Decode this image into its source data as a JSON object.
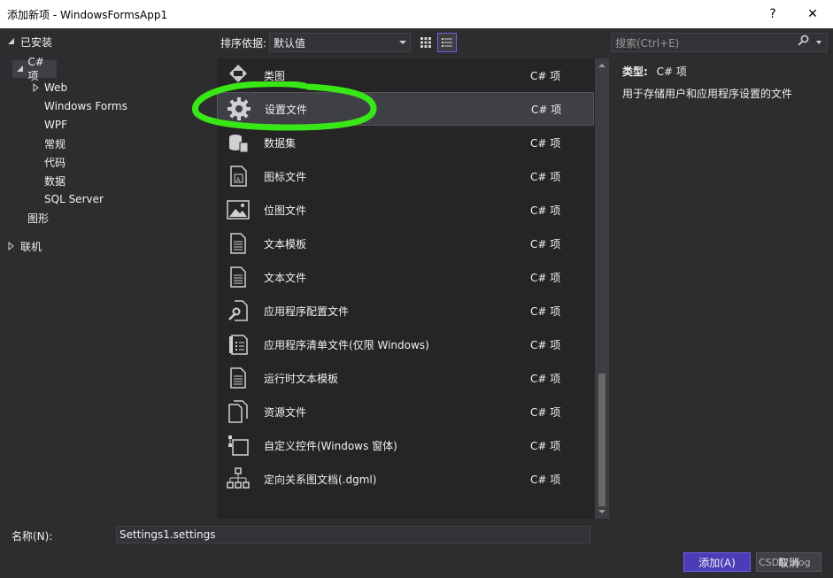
{
  "window": {
    "title": "添加新项 - WindowsFormsApp1",
    "help": "?",
    "close": "✕"
  },
  "tree": {
    "installed": "已安装",
    "csharp": "C# 项",
    "web": "Web",
    "winforms": "Windows Forms",
    "wpf": "WPF",
    "general": "常规",
    "code": "代码",
    "data": "数据",
    "sql": "SQL Server",
    "graphics": "图形",
    "online": "联机"
  },
  "toolbar": {
    "sort_label": "排序依据:",
    "sort_value": "默认值"
  },
  "search": {
    "placeholder": "搜索(Ctrl+E)"
  },
  "items": [
    {
      "name": "类图",
      "type": "C# 项",
      "icon": "class-diagram-icon"
    },
    {
      "name": "设置文件",
      "type": "C# 项",
      "icon": "gear-icon"
    },
    {
      "name": "数据集",
      "type": "C# 项",
      "icon": "dataset-icon"
    },
    {
      "name": "图标文件",
      "type": "C# 项",
      "icon": "icon-file-icon"
    },
    {
      "name": "位图文件",
      "type": "C# 项",
      "icon": "bitmap-icon"
    },
    {
      "name": "文本模板",
      "type": "C# 项",
      "icon": "text-template-icon"
    },
    {
      "name": "文本文件",
      "type": "C# 项",
      "icon": "text-file-icon"
    },
    {
      "name": "应用程序配置文件",
      "type": "C# 项",
      "icon": "config-file-icon"
    },
    {
      "name": "应用程序清单文件(仅限 Windows)",
      "type": "C# 项",
      "icon": "manifest-icon"
    },
    {
      "name": "运行时文本模板",
      "type": "C# 项",
      "icon": "runtime-template-icon"
    },
    {
      "name": "资源文件",
      "type": "C# 项",
      "icon": "resource-file-icon"
    },
    {
      "name": "自定义控件(Windows 窗体)",
      "type": "C# 项",
      "icon": "custom-control-icon"
    },
    {
      "name": "定向关系图文档(.dgml)",
      "type": "C# 项",
      "icon": "dgml-icon"
    }
  ],
  "details": {
    "type_label": "类型:",
    "type_value": "C# 项",
    "description": "用于存储用户和应用程序设置的文件"
  },
  "bottom": {
    "name_label": "名称(N):",
    "name_value": "Settings1.settings",
    "add": "添加(A)",
    "cancel": "取消",
    "watermark": "CSDN blog"
  },
  "colors": {
    "background": "#2d2d30",
    "panel": "#252526",
    "selection": "#3f3f46",
    "accent": "#7160e8",
    "annotation": "#39e616"
  }
}
